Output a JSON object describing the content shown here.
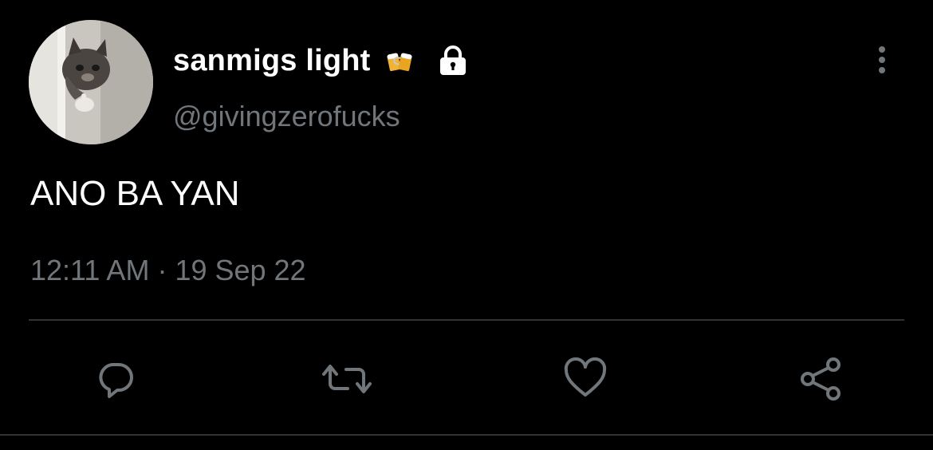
{
  "tweet": {
    "author": {
      "display_name": "sanmigs light",
      "handle": "@givingzerofucks",
      "protected": true
    },
    "text": "ANO BA YAN",
    "time": "12:11 AM",
    "separator": "·",
    "date": "19 Sep 22"
  },
  "icons": {
    "name_emoji": "beer-mugs-icon",
    "lock": "lock-icon",
    "more": "more-vertical-icon",
    "reply": "reply-icon",
    "retweet": "retweet-icon",
    "like": "like-heart-icon",
    "share": "share-icon"
  },
  "colors": {
    "background": "#000000",
    "primary_text": "#ffffff",
    "secondary_text": "#71767b",
    "divider": "#2f3336"
  }
}
